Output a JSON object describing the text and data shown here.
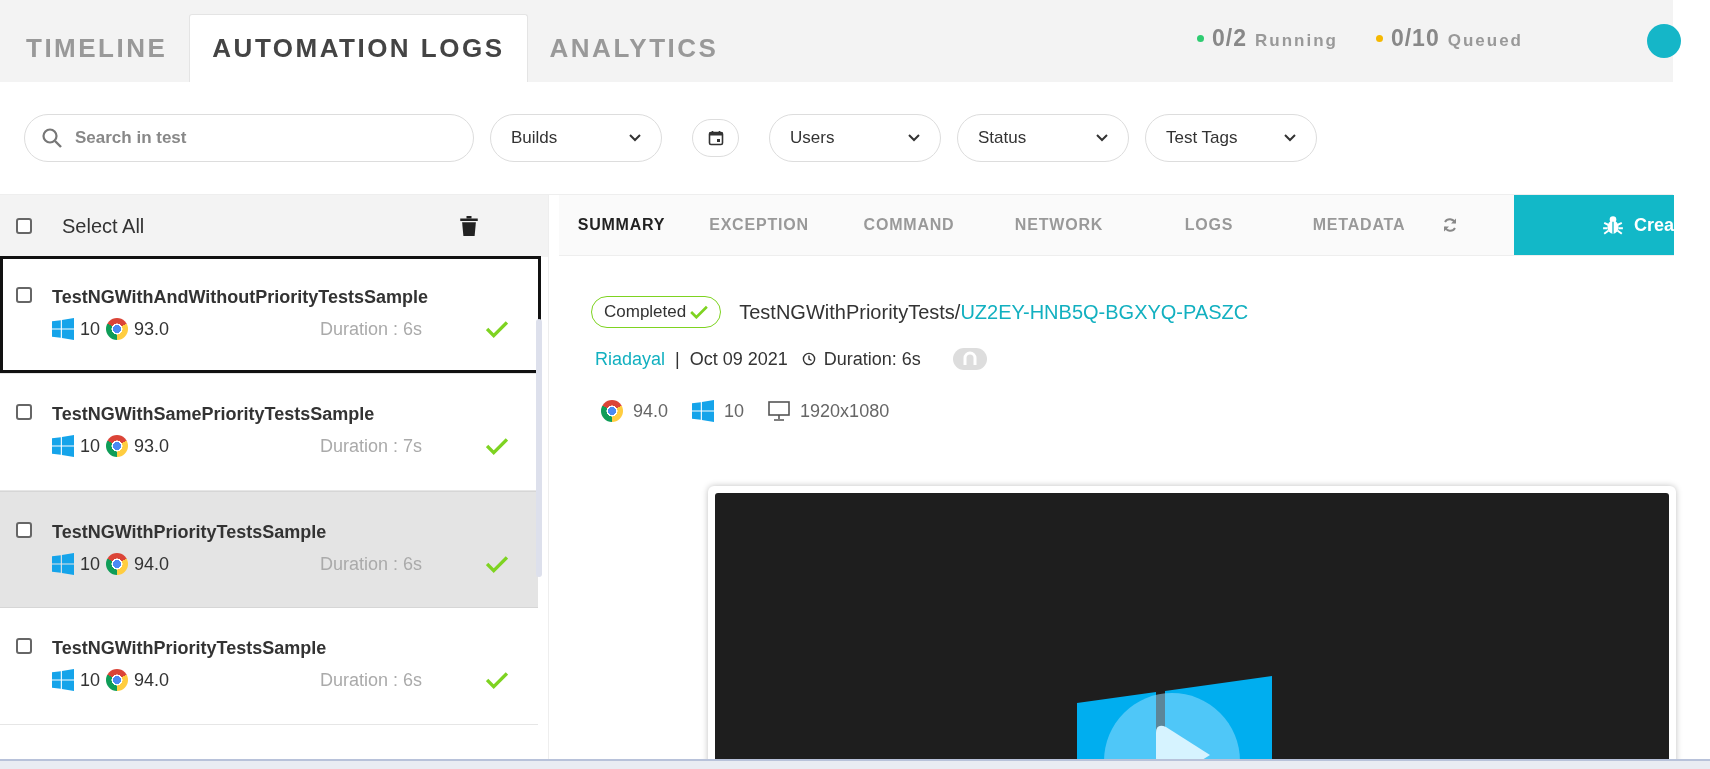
{
  "tabs": [
    {
      "label": "TIMELINE",
      "selected": false
    },
    {
      "label": "AUTOMATION LOGS",
      "selected": true
    },
    {
      "label": "ANALYTICS",
      "selected": false
    }
  ],
  "queue": [
    {
      "count": "0/2",
      "label": "Running",
      "color": "#2ecc71"
    },
    {
      "count": "0/10",
      "label": "Queued",
      "color": "#f5b800"
    }
  ],
  "filters": {
    "search": {
      "placeholder": "Search in test"
    },
    "controls": [
      {
        "kind": "dropdown",
        "label": "Builds"
      },
      {
        "kind": "date"
      },
      {
        "kind": "dropdown",
        "label": "Users"
      },
      {
        "kind": "dropdown",
        "label": "Status"
      },
      {
        "kind": "dropdown",
        "label": "Test Tags"
      }
    ]
  },
  "list": {
    "select_all": {
      "label": "Select All",
      "checked": false
    },
    "items": [
      {
        "name": "TestNGWithAndWithoutPriorityTestsSample",
        "os_version": "10",
        "browser_version": "93.0",
        "duration": "Duration : 6s",
        "checked": false,
        "selected": true,
        "hovered": false,
        "passed": true
      },
      {
        "name": "TestNGWithSamePriorityTestsSample",
        "os_version": "10",
        "browser_version": "93.0",
        "duration": "Duration : 7s",
        "checked": false,
        "selected": false,
        "hovered": false,
        "passed": true
      },
      {
        "name": "TestNGWithPriorityTestsSample",
        "os_version": "10",
        "browser_version": "94.0",
        "duration": "Duration : 6s",
        "checked": false,
        "selected": false,
        "hovered": true,
        "passed": true
      },
      {
        "name": "TestNGWithPriorityTestsSample",
        "os_version": "10",
        "browser_version": "94.0",
        "duration": "Duration : 6s",
        "checked": false,
        "selected": false,
        "hovered": false,
        "passed": true
      }
    ]
  },
  "detail": {
    "tabs": [
      {
        "label": "SUMMARY",
        "selected": true
      },
      {
        "label": "EXCEPTION",
        "selected": false
      },
      {
        "label": "COMMAND",
        "selected": false
      },
      {
        "label": "NETWORK",
        "selected": false
      },
      {
        "label": "LOGS",
        "selected": false
      },
      {
        "label": "METADATA",
        "selected": false
      }
    ],
    "create_button": "Crea",
    "status": {
      "label": "Completed",
      "passed": true
    },
    "test_name": "TestNGWithPriorityTests/",
    "test_id": "UZ2EY-HNB5Q-BGXYQ-PASZC",
    "user": "Riadayal",
    "separator": "|",
    "date": "Oct 09 2021",
    "duration": "Duration: 6s",
    "env": {
      "browser_version": "94.0",
      "os_version": "10",
      "resolution": "1920x1080"
    }
  }
}
